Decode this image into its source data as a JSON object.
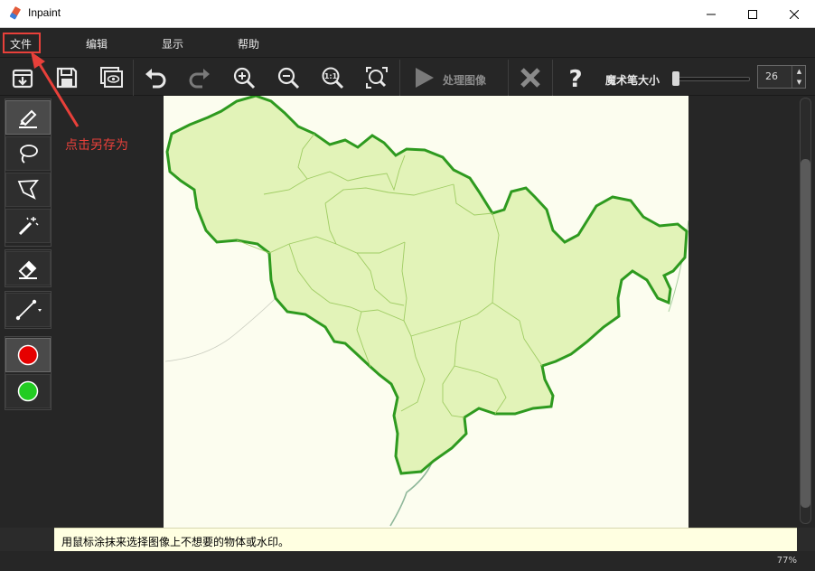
{
  "window": {
    "title": "Inpaint"
  },
  "menu": {
    "items": [
      "文件",
      "编辑",
      "显示",
      "帮助"
    ]
  },
  "toolbar": {
    "process_label": "处理图像",
    "brush_size_label": "魔术笔大小",
    "brush_size_value": "26"
  },
  "hint": {
    "text": "用鼠标涂抹来选择图像上不想要的物体或水印。"
  },
  "status": {
    "zoom": "77%"
  },
  "annotation": {
    "text": "点击另存为",
    "color": "#e8403a"
  },
  "colors": {
    "red_marker": "#e60000",
    "green_marker": "#22cc22",
    "map_fill": "#e2f3b8",
    "map_border": "#2e9a1f"
  }
}
